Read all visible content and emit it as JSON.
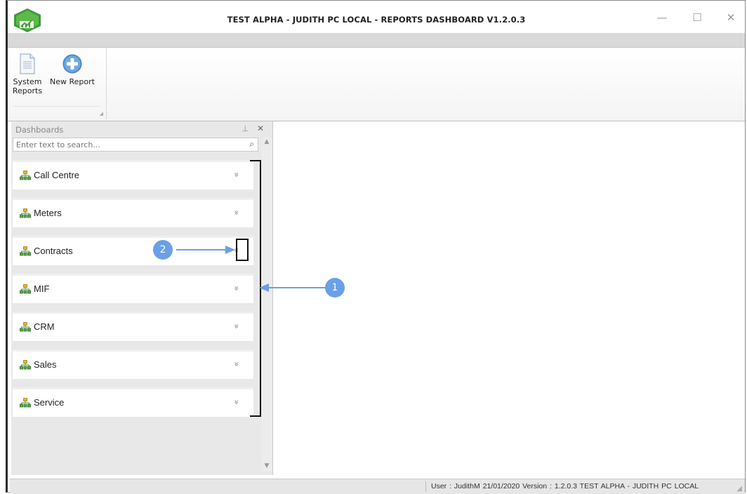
{
  "window": {
    "title": "TEST ALPHA - JUDITH PC LOCAL - REPORTS DASHBOARD V1.2.0.3",
    "minimize_glyph": "—",
    "maximize_glyph": "☐",
    "close_glyph": "✕"
  },
  "ribbon": {
    "buttons": [
      {
        "label_line1": "System",
        "label_line2": "Reports",
        "icon": "document-icon"
      },
      {
        "label_line1": "New Report",
        "label_line2": "",
        "icon": "plus-circle-icon"
      }
    ]
  },
  "panel": {
    "title": "Dashboards",
    "pin_glyph": "⊥",
    "close_glyph": "✕",
    "search_placeholder": "Enter text to search...",
    "search_glyph": "⌕",
    "items": [
      {
        "label": "Call Centre",
        "icon": "org-chart-icon",
        "chevron": "»"
      },
      {
        "label": "Meters",
        "icon": "org-chart-icon",
        "chevron": "»"
      },
      {
        "label": "Contracts",
        "icon": "org-chart-icon",
        "chevron": "»"
      },
      {
        "label": "MIF",
        "icon": "org-chart-icon",
        "chevron": "»"
      },
      {
        "label": "CRM",
        "icon": "org-chart-icon",
        "chevron": "»"
      },
      {
        "label": "Sales",
        "icon": "org-chart-icon",
        "chevron": "»"
      },
      {
        "label": "Service",
        "icon": "org-chart-icon",
        "chevron": "»"
      }
    ]
  },
  "annotations": {
    "callout_1": "1",
    "callout_2": "2",
    "accent": "#6b9fe6"
  },
  "statusbar": {
    "text": "User : JudithM   21/01/2020   Version : 1.2.0.3   TEST ALPHA - JUDITH PC LOCAL"
  }
}
